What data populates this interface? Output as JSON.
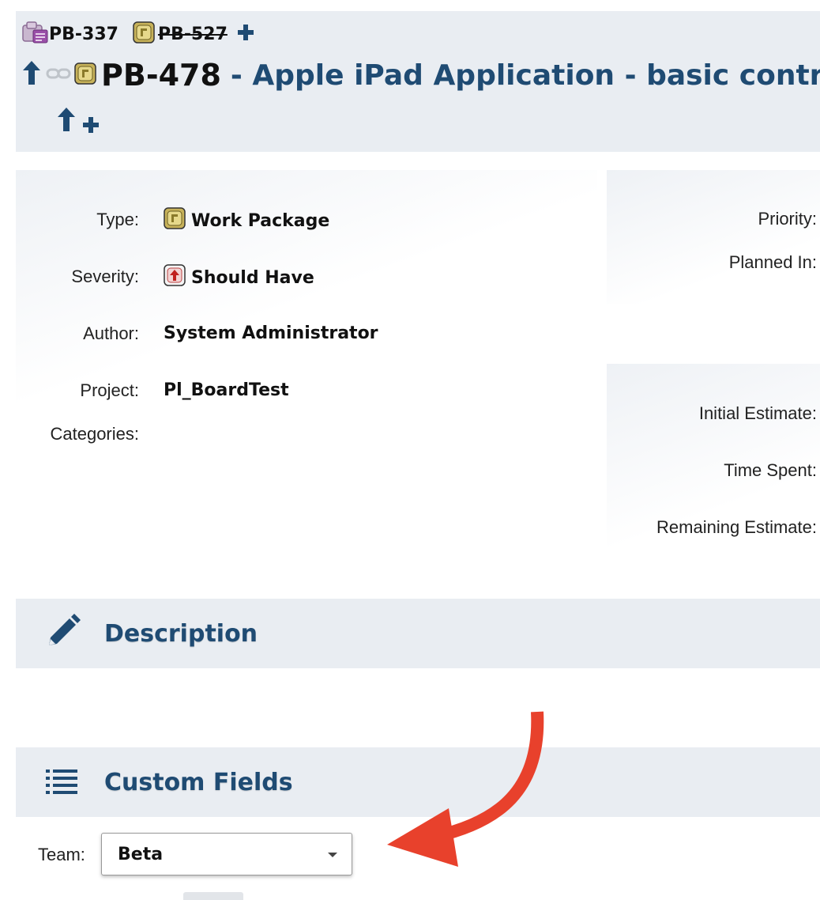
{
  "header": {
    "parents": [
      {
        "key": "PB-337",
        "icon": "product-icon",
        "struck": false
      },
      {
        "key": "PB-527",
        "icon": "work-package-icon",
        "struck": true
      }
    ],
    "issue_key": "PB-478",
    "issue_title": "- Apple iPad Application - basic control"
  },
  "details": {
    "fields": [
      {
        "label": "Type:",
        "value": "Work Package",
        "icon": "work-package-icon"
      },
      {
        "label": "Severity:",
        "value": "Should Have",
        "icon": "should-have-icon"
      },
      {
        "label": "Author:",
        "value": "System Administrator"
      },
      {
        "label": "Project:",
        "value": "Pl_BoardTest"
      },
      {
        "label": "Categories:",
        "value": ""
      }
    ],
    "right_fields": [
      {
        "label": "Priority:"
      },
      {
        "label": "Planned In:"
      },
      {
        "label": "Initial Estimate:"
      },
      {
        "label": "Time Spent:"
      },
      {
        "label": "Remaining Estimate:"
      }
    ]
  },
  "sections": {
    "description": "Description",
    "custom_fields": "Custom Fields"
  },
  "custom_fields": {
    "team_label": "Team:",
    "team_value": "Beta"
  },
  "colors": {
    "accent": "#1f4b73",
    "panel": "#e9edf2",
    "annotation_arrow": "#e8412c"
  }
}
